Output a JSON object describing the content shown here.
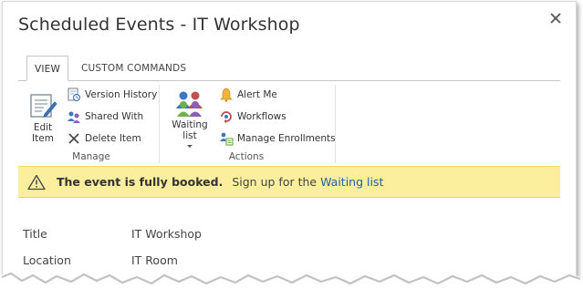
{
  "dialog": {
    "title": "Scheduled Events - IT Workshop",
    "close_icon": "close-icon"
  },
  "tabs": [
    {
      "label": "VIEW",
      "active": true
    },
    {
      "label": "CUSTOM COMMANDS",
      "active": false
    }
  ],
  "ribbon": {
    "manage": {
      "label": "Manage",
      "edit_item": {
        "line1": "Edit",
        "line2": "Item",
        "icon": "edit-item-icon"
      },
      "version_history": {
        "label": "Version History",
        "icon": "version-history-icon"
      },
      "shared_with": {
        "label": "Shared With",
        "icon": "shared-with-icon"
      },
      "delete_item": {
        "label": "Delete Item",
        "icon": "delete-icon"
      }
    },
    "actions": {
      "label": "Actions",
      "waiting_list": {
        "label": "Waiting list",
        "icon": "people-icon"
      },
      "alert_me": {
        "label": "Alert Me",
        "icon": "bell-icon"
      },
      "workflows": {
        "label": "Workflows",
        "icon": "workflow-icon"
      },
      "manage_enrollments": {
        "label": "Manage Enrollments",
        "icon": "enrollments-icon"
      }
    }
  },
  "notice": {
    "icon": "warning-icon",
    "bold": "The event is fully booked.",
    "text": "Sign up for the",
    "link": "Waiting list",
    "color": "#fbef9d"
  },
  "fields": [
    {
      "label": "Title",
      "value": "IT Workshop"
    },
    {
      "label": "Location",
      "value": "IT Room"
    }
  ]
}
